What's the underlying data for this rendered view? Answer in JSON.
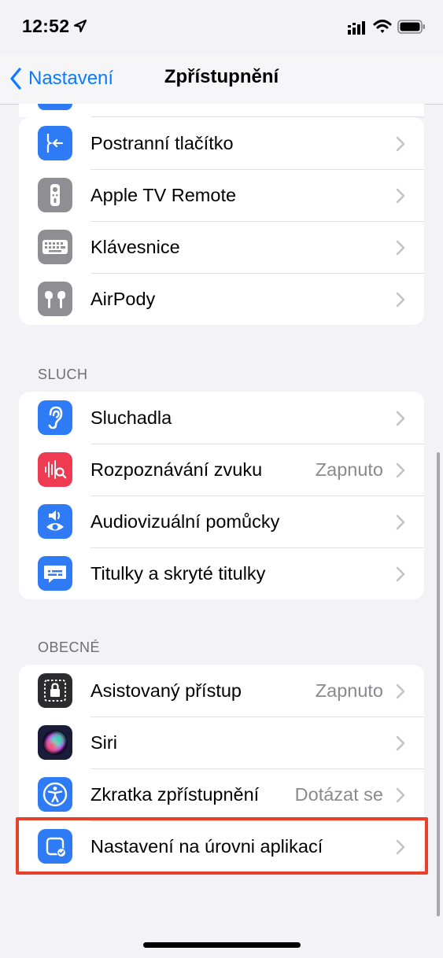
{
  "status": {
    "time": "12:52"
  },
  "nav": {
    "back_label": "Nastavení",
    "title": "Zpřístupnění"
  },
  "groups": [
    {
      "header": "",
      "rows": [
        {
          "label": "Postranní tlačítko",
          "value": "",
          "icon": "side-button-icon",
          "color": "#2f7bf5"
        },
        {
          "label": "Apple TV Remote",
          "value": "",
          "icon": "tv-remote-icon",
          "color": "#8e8e93"
        },
        {
          "label": "Klávesnice",
          "value": "",
          "icon": "keyboard-icon",
          "color": "#8e8e93"
        },
        {
          "label": "AirPody",
          "value": "",
          "icon": "airpods-icon",
          "color": "#8e8e93"
        }
      ]
    },
    {
      "header": "SLUCH",
      "rows": [
        {
          "label": "Sluchadla",
          "value": "",
          "icon": "ear-icon",
          "color": "#2f7bf5"
        },
        {
          "label": "Rozpoznávání zvuku",
          "value": "Zapnuto",
          "icon": "sound-recognition-icon",
          "color": "#ef3b52"
        },
        {
          "label": "Audiovizuální pomůcky",
          "value": "",
          "icon": "audio-visual-icon",
          "color": "#2f7bf5"
        },
        {
          "label": "Titulky a skryté titulky",
          "value": "",
          "icon": "subtitles-icon",
          "color": "#2f7bf5"
        }
      ]
    },
    {
      "header": "OBECNÉ",
      "rows": [
        {
          "label": "Asistovaný přístup",
          "value": "Zapnuto",
          "icon": "guided-access-icon",
          "color": "#2c2c2e"
        },
        {
          "label": "Siri",
          "value": "",
          "icon": "siri-icon",
          "color": "#1b1b3a"
        },
        {
          "label": "Zkratka zpřístupnění",
          "value": "Dotázat se",
          "icon": "accessibility-icon",
          "color": "#2f7bf5"
        },
        {
          "label": "Nastavení na úrovni aplikací",
          "value": "",
          "icon": "per-app-settings-icon",
          "color": "#2f7bf5"
        }
      ]
    }
  ]
}
